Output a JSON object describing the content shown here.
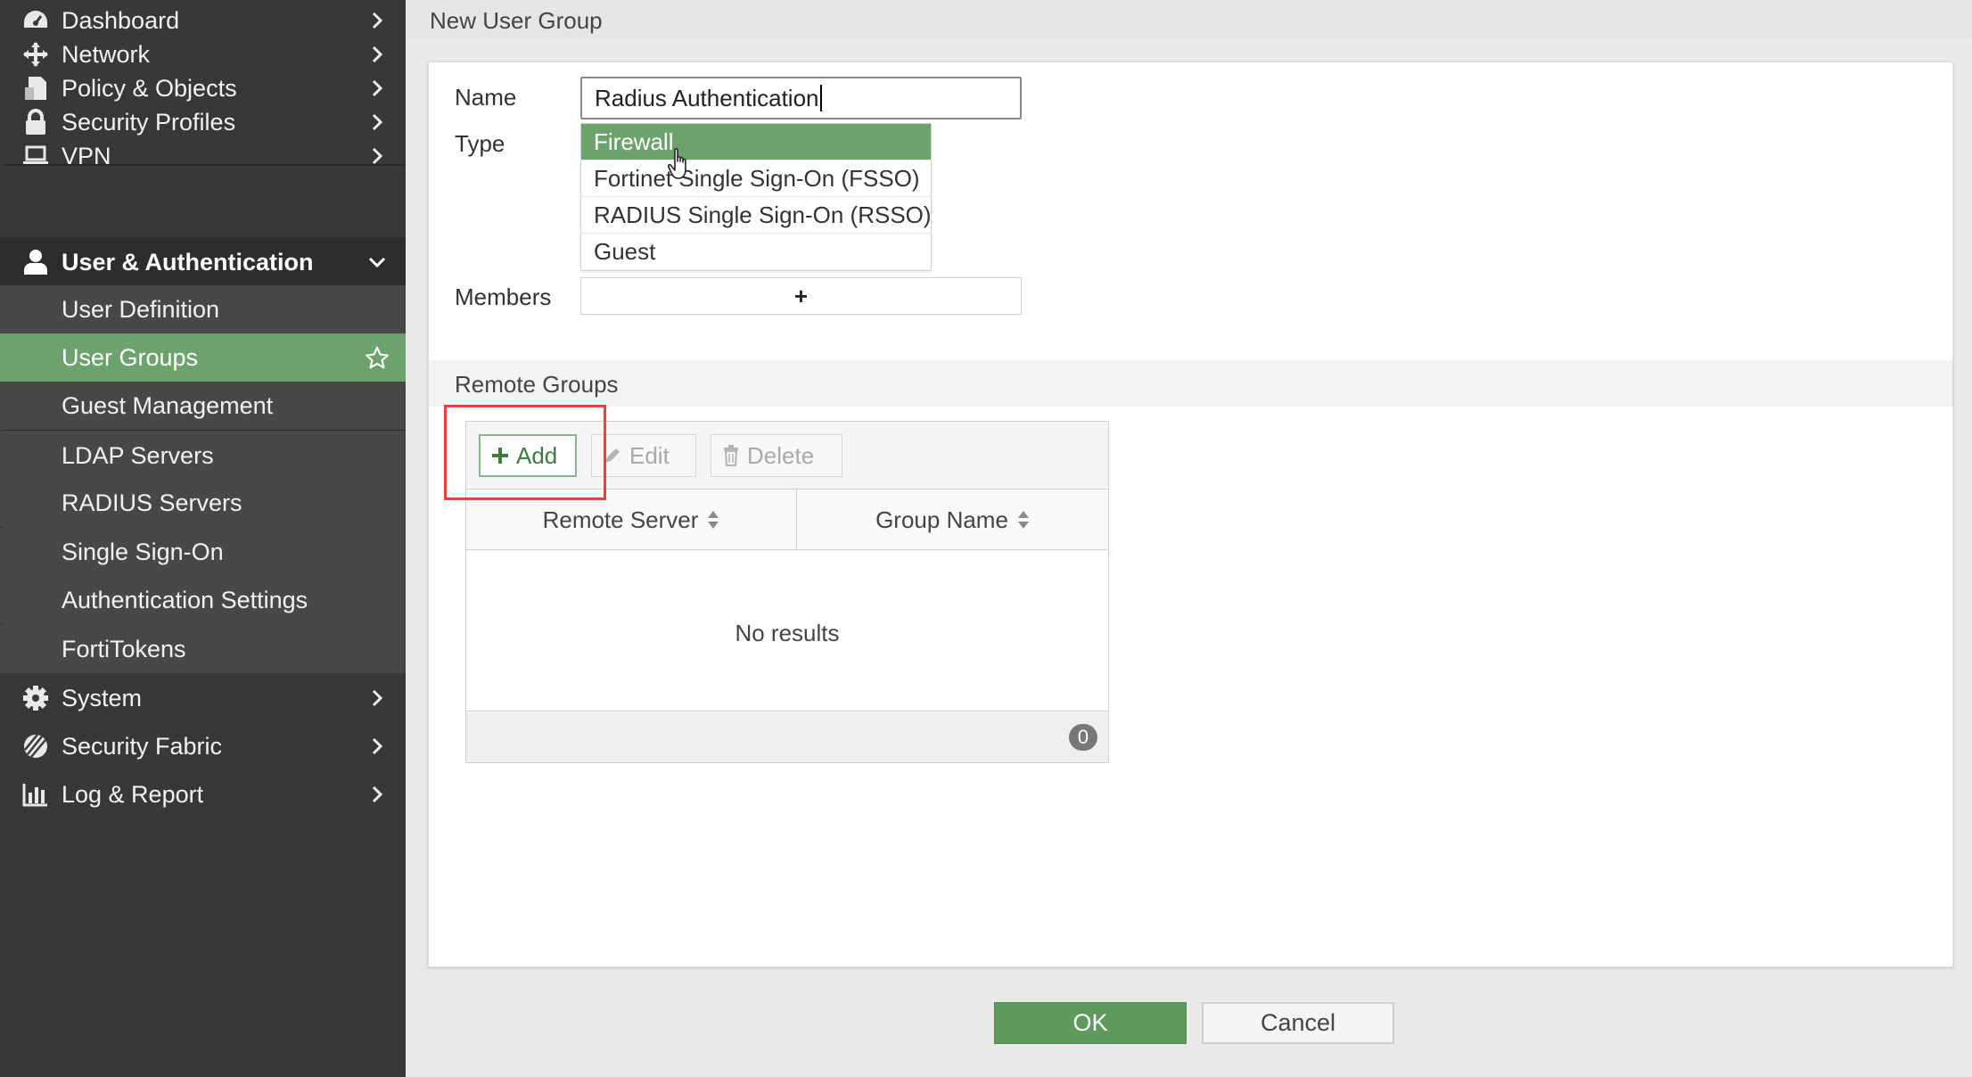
{
  "sidebar": {
    "items": [
      {
        "label": "Dashboard",
        "icon": "dashboard-icon"
      },
      {
        "label": "Network",
        "icon": "network-icon"
      },
      {
        "label": "Policy & Objects",
        "icon": "policy-objects-icon"
      },
      {
        "label": "Security Profiles",
        "icon": "lock-icon"
      },
      {
        "label": "VPN",
        "icon": "laptop-icon"
      },
      {
        "label": "User & Authentication",
        "icon": "user-icon"
      }
    ],
    "sub_items": [
      {
        "label": "User Definition"
      },
      {
        "label": "User Groups"
      },
      {
        "label": "Guest Management"
      },
      {
        "label": "LDAP Servers"
      },
      {
        "label": "RADIUS Servers"
      },
      {
        "label": "Single Sign-On"
      },
      {
        "label": "Authentication Settings"
      },
      {
        "label": "FortiTokens"
      }
    ],
    "bottom_items": [
      {
        "label": "System",
        "icon": "gear-icon"
      },
      {
        "label": "Security Fabric",
        "icon": "security-fabric-icon"
      },
      {
        "label": "Log & Report",
        "icon": "bar-chart-icon"
      }
    ],
    "active_sub_item": "User Groups",
    "accent_color": "#6ca36c"
  },
  "header": {
    "title": "New User Group"
  },
  "form": {
    "name_label": "Name",
    "name_value": "Radius Authentication",
    "type_label": "Type",
    "type_options": [
      "Firewall",
      "Fortinet Single Sign-On (FSSO)",
      "RADIUS Single Sign-On (RSSO)",
      "Guest"
    ],
    "type_selected": "Firewall",
    "members_label": "Members",
    "members_add": "+"
  },
  "remote_groups": {
    "title": "Remote Groups",
    "toolbar": {
      "add_label": "Add",
      "edit_label": "Edit",
      "delete_label": "Delete"
    },
    "columns": [
      "Remote Server",
      "Group Name"
    ],
    "empty_text": "No results",
    "count": "0"
  },
  "footer": {
    "ok_label": "OK",
    "cancel_label": "Cancel"
  }
}
